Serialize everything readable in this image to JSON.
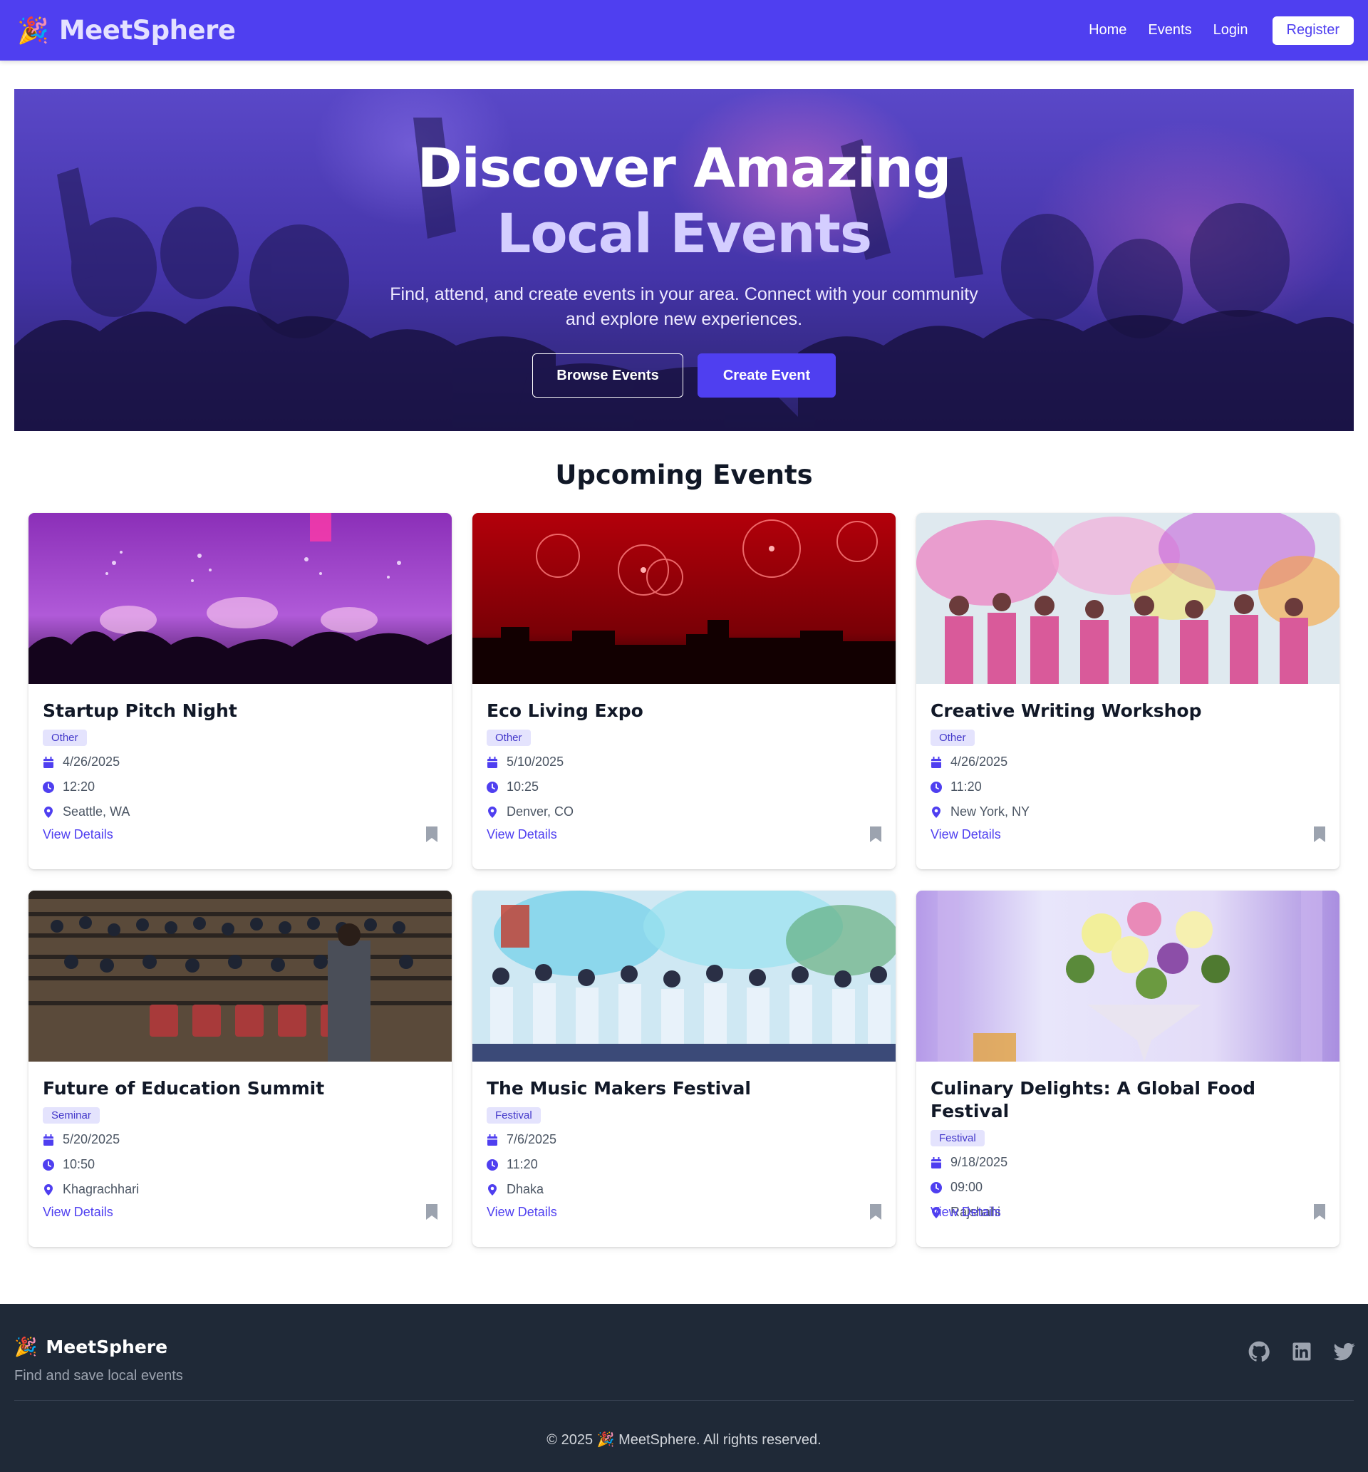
{
  "nav": {
    "logo_emoji": "🎉",
    "brand": "MeetSphere",
    "links": [
      "Home",
      "Events",
      "Login"
    ],
    "register_label": "Register",
    "bg_color": "#4f3ff0"
  },
  "hero": {
    "title_line1": "Discover Amazing",
    "title_line2": "Local Events",
    "subtitle": "Find, attend, and create events in your area. Connect with your community and explore new experiences.",
    "browse_label": "Browse Events",
    "create_label": "Create Event"
  },
  "events_section": {
    "title": "Upcoming Events",
    "view_details_label": "View Details",
    "cards": [
      {
        "title": "Startup Pitch Night",
        "category": "Other",
        "date": "4/26/2025",
        "time": "12:20",
        "location": "Seattle, WA",
        "image": "purple-fireworks-concert"
      },
      {
        "title": "Eco Living Expo",
        "category": "Other",
        "date": "5/10/2025",
        "time": "10:25",
        "location": "Denver, CO",
        "image": "red-fireworks-city"
      },
      {
        "title": "Creative Writing Workshop",
        "category": "Other",
        "date": "4/26/2025",
        "time": "11:20",
        "location": "New York, NY",
        "image": "color-powder-festival"
      },
      {
        "title": "Future of Education Summit",
        "category": "Seminar",
        "date": "5/20/2025",
        "time": "10:50",
        "location": "Khagrachhari",
        "image": "auditorium-seminar"
      },
      {
        "title": "The Music Makers Festival",
        "category": "Festival",
        "date": "7/6/2025",
        "time": "11:20",
        "location": "Dhaka",
        "image": "blue-powder-festival"
      },
      {
        "title": "Culinary Delights: A Global Food Festival",
        "category": "Festival",
        "date": "9/18/2025",
        "time": "09:00",
        "location": "Rajshahi",
        "image": "flower-bouquet-table"
      }
    ]
  },
  "footer": {
    "logo_emoji": "🎉",
    "brand": "MeetSphere",
    "tagline": "Find and save local events",
    "social_icons": [
      "github-icon",
      "linkedin-icon",
      "twitter-icon"
    ],
    "copyright": "© 2025 🎉 MeetSphere. All rights reserved."
  }
}
